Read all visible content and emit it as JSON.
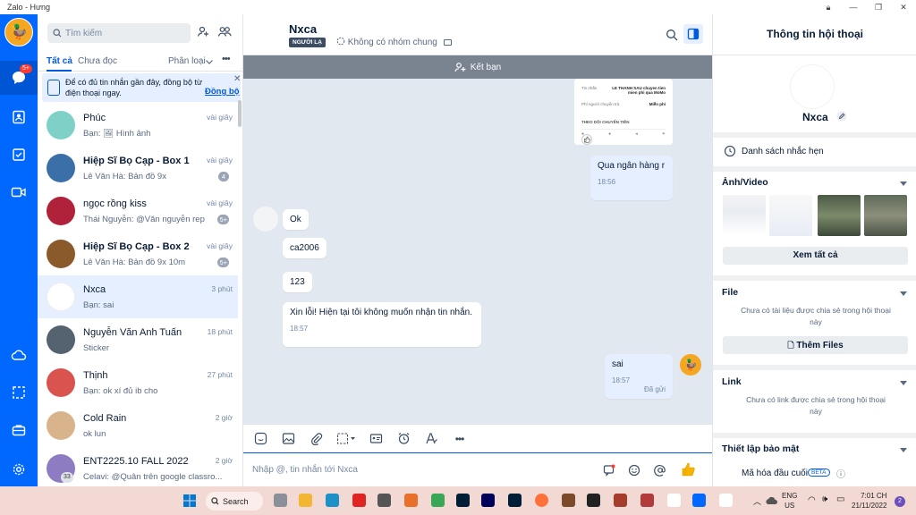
{
  "window": {
    "title": "Zalo - Hưng"
  },
  "nav": {
    "chat_badge": "5+"
  },
  "list": {
    "search_placeholder": "Tìm kiếm",
    "tab_all": "Tất cả",
    "tab_unread": "Chưa đọc",
    "classify": "Phân loại",
    "sync_banner_text": "Để có đủ tin nhắn gần đây, đồng bộ từ điện thoại ngay.",
    "sync_link": "Đồng bộ",
    "conversations": [
      {
        "name": "Phúc",
        "preview": "Bạn: 🖼 Hình ảnh",
        "time": "vài giây",
        "count": "",
        "color": "#7fd1c8"
      },
      {
        "name": "Hiệp Sĩ Bọ Cạp - Box 1",
        "preview": "Lê Văn Hà: Bản đồ 9x",
        "time": "vài giây",
        "count": "4",
        "color": "#3b6fa8"
      },
      {
        "name": "ngọc rồng kiss",
        "preview": "Thái Nguyễn: @Văn nguyễn rep",
        "time": "vài giây",
        "count": "5+",
        "color": "#b0213a"
      },
      {
        "name": "Hiệp Sĩ Bọ Cạp - Box 2",
        "preview": "Lê Văn Hà: Bản đồ 9x 10m",
        "time": "vài giây",
        "count": "5+",
        "color": "#8a5a2b"
      },
      {
        "name": "Nxca",
        "preview": "Bạn: sai",
        "time": "3 phút",
        "count": "",
        "color": "#ffffff"
      },
      {
        "name": "Nguyễn Văn Anh Tuấn",
        "preview": "Sticker",
        "time": "18 phút",
        "count": "",
        "color": "#556270"
      },
      {
        "name": "Thịnh",
        "preview": "Bạn: ok xí đủ ib cho",
        "time": "27 phút",
        "count": "",
        "color": "#d9534f"
      },
      {
        "name": "Cold Rain",
        "preview": "ok lun",
        "time": "2 giờ",
        "count": "",
        "color": "#d9b38c"
      },
      {
        "name": "ENT2225.10 FALL 2022",
        "preview": "Celavi: @Quân trên google classro...",
        "time": "2 giờ",
        "count": "",
        "color": "#8e7cc3"
      }
    ],
    "group_member_count": "33"
  },
  "chat": {
    "contact_name": "Nxca",
    "stranger_badge": "NGƯỜI LẠ",
    "no_common_group": "Không có nhóm chung",
    "add_friend": "Kết bạn",
    "transfer_preview": {
      "row1_label": "Tin nhắn",
      "row1_value": "LE THANH SAU chuyen tien mien phi qua MoMo",
      "row2_label": "Phí người chuyển trả",
      "row2_value": "Miễn phí",
      "footer": "THEO DÕI CHUYỂN TIỀN"
    },
    "messages": [
      {
        "text": "Qua ngân hàng r",
        "time": "18:56"
      },
      {
        "text": "Ok"
      },
      {
        "text": "ca2006"
      },
      {
        "text": "123"
      },
      {
        "text": "Xin lỗi! Hiện tại tôi không muốn nhận tin nhắn.",
        "time": "18:57"
      },
      {
        "text": "sai",
        "time": "18:57",
        "status": "Đã gửi"
      }
    ],
    "input_placeholder": "Nhập @, tin nhắn tới Nxca"
  },
  "info": {
    "title": "Thông tin hội thoại",
    "name": "Nxca",
    "reminders": "Danh sách nhắc hẹn",
    "media_title": "Ảnh/Video",
    "see_all": "Xem tất cả",
    "file_title": "File",
    "file_empty": "Chưa có tài liệu được chia sẻ trong hội thoại này",
    "add_files": "Thêm Files",
    "link_title": "Link",
    "link_empty": "Chưa có link được chia sẻ trong hội thoại này",
    "security_title": "Thiết lập bảo mật",
    "e2e": "Mã hóa đầu cuối",
    "beta": "BETA"
  },
  "taskbar": {
    "search": "Search",
    "lang_line1": "ENG",
    "lang_line2": "US",
    "time": "7:01 CH",
    "date": "21/11/2022",
    "notifications": "2"
  }
}
